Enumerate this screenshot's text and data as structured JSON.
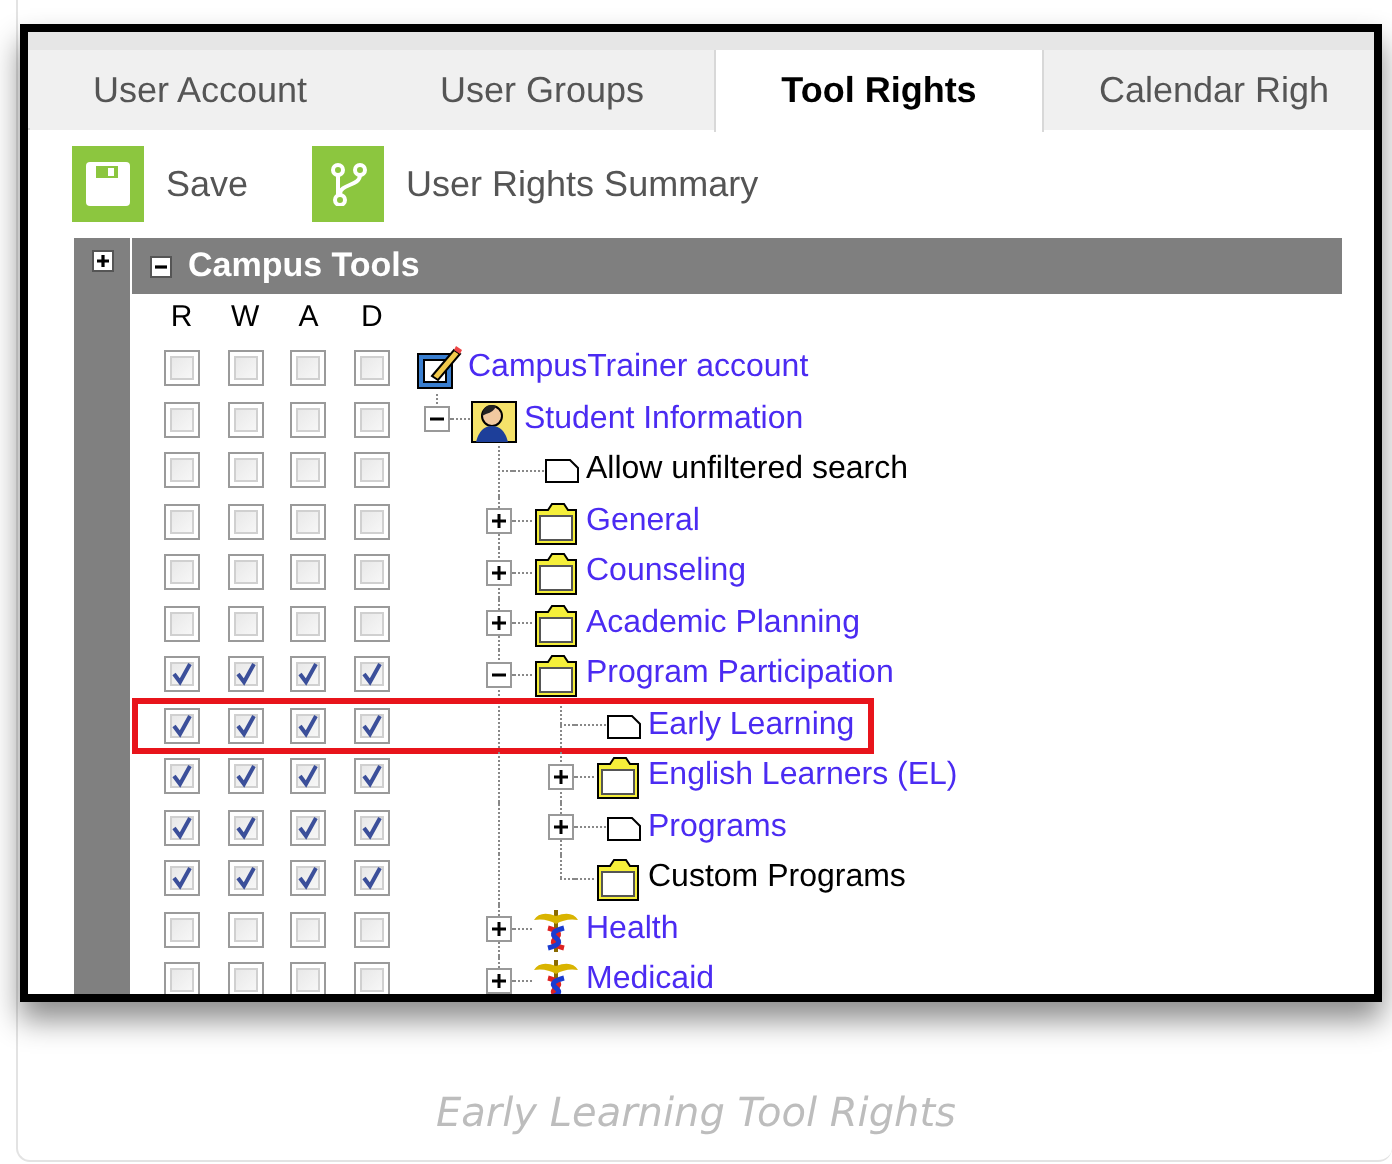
{
  "tabs": [
    {
      "label": "User Account",
      "selected": false
    },
    {
      "label": "User Groups",
      "selected": false
    },
    {
      "label": "Tool Rights",
      "selected": true
    },
    {
      "label": "Calendar Righ",
      "selected": false
    }
  ],
  "toolbar": [
    {
      "label": "Save",
      "kind": "save"
    },
    {
      "label": "User Rights Summary",
      "kind": "summary"
    }
  ],
  "panel": {
    "title": "Campus Tools",
    "expanded": true,
    "columns": [
      "R",
      "W",
      "A",
      "D"
    ],
    "tree": [
      {
        "label": "CampusTrainer account",
        "kind": "account",
        "link": true,
        "highlighted": false,
        "rights": [
          {
            "checked": false
          },
          {
            "checked": false
          },
          {
            "checked": false
          },
          {
            "checked": false
          }
        ],
        "children": [
          {
            "label": "Student Information",
            "kind": "person",
            "link": true,
            "expanded": true,
            "highlighted": false,
            "rights": [
              {
                "checked": false
              },
              {
                "checked": false
              },
              {
                "checked": false
              },
              {
                "checked": false
              }
            ],
            "children": [
              {
                "label": "Allow unfiltered search",
                "kind": "page",
                "link": false,
                "highlighted": false,
                "rights": [
                  {
                    "checked": false
                  },
                  {
                    "checked": false
                  },
                  {
                    "checked": false
                  },
                  {
                    "checked": false
                  }
                ]
              },
              {
                "label": "General",
                "kind": "folder",
                "link": true,
                "expanded": false,
                "highlighted": false,
                "rights": [
                  {
                    "checked": false
                  },
                  {
                    "checked": false
                  },
                  {
                    "checked": false
                  },
                  {
                    "checked": false
                  }
                ]
              },
              {
                "label": "Counseling",
                "kind": "folder",
                "link": true,
                "expanded": false,
                "highlighted": false,
                "rights": [
                  {
                    "checked": false
                  },
                  {
                    "checked": false
                  },
                  {
                    "checked": false
                  },
                  {
                    "checked": false
                  }
                ]
              },
              {
                "label": "Academic Planning",
                "kind": "folder",
                "link": true,
                "expanded": false,
                "highlighted": false,
                "rights": [
                  {
                    "checked": false
                  },
                  {
                    "checked": false
                  },
                  {
                    "checked": false
                  },
                  {
                    "checked": false
                  }
                ]
              },
              {
                "label": "Program Participation",
                "kind": "folder",
                "link": true,
                "expanded": true,
                "highlighted": false,
                "rights": [
                  {
                    "checked": true
                  },
                  {
                    "checked": true
                  },
                  {
                    "checked": true
                  },
                  {
                    "checked": true
                  }
                ],
                "children": [
                  {
                    "label": "Early Learning",
                    "kind": "page",
                    "link": true,
                    "highlighted": true,
                    "rights": [
                      {
                        "checked": true
                      },
                      {
                        "checked": true
                      },
                      {
                        "checked": true
                      },
                      {
                        "checked": true
                      }
                    ]
                  },
                  {
                    "label": "English Learners (EL)",
                    "kind": "folder",
                    "link": true,
                    "expanded": false,
                    "highlighted": false,
                    "rights": [
                      {
                        "checked": true
                      },
                      {
                        "checked": true
                      },
                      {
                        "checked": true
                      },
                      {
                        "checked": true
                      }
                    ]
                  },
                  {
                    "label": "Programs",
                    "kind": "page",
                    "link": true,
                    "expanded": false,
                    "highlighted": false,
                    "rights": [
                      {
                        "checked": true
                      },
                      {
                        "checked": true
                      },
                      {
                        "checked": true
                      },
                      {
                        "checked": true
                      }
                    ]
                  },
                  {
                    "label": "Custom Programs",
                    "kind": "folder",
                    "link": false,
                    "highlighted": false,
                    "rights": [
                      {
                        "checked": true
                      },
                      {
                        "checked": true
                      },
                      {
                        "checked": true
                      },
                      {
                        "checked": true
                      }
                    ]
                  }
                ]
              },
              {
                "label": "Health",
                "kind": "medical",
                "link": true,
                "expanded": false,
                "highlighted": false,
                "rights": [
                  {
                    "checked": false
                  },
                  {
                    "checked": false
                  },
                  {
                    "checked": false
                  },
                  {
                    "checked": false
                  }
                ]
              },
              {
                "label": "Medicaid",
                "kind": "medical",
                "link": true,
                "expanded": false,
                "highlighted": false,
                "rights": [
                  {
                    "checked": false
                  },
                  {
                    "checked": false
                  },
                  {
                    "checked": false
                  },
                  {
                    "checked": false
                  }
                ]
              }
            ]
          }
        ]
      }
    ]
  },
  "caption": "Early Learning Tool Rights"
}
